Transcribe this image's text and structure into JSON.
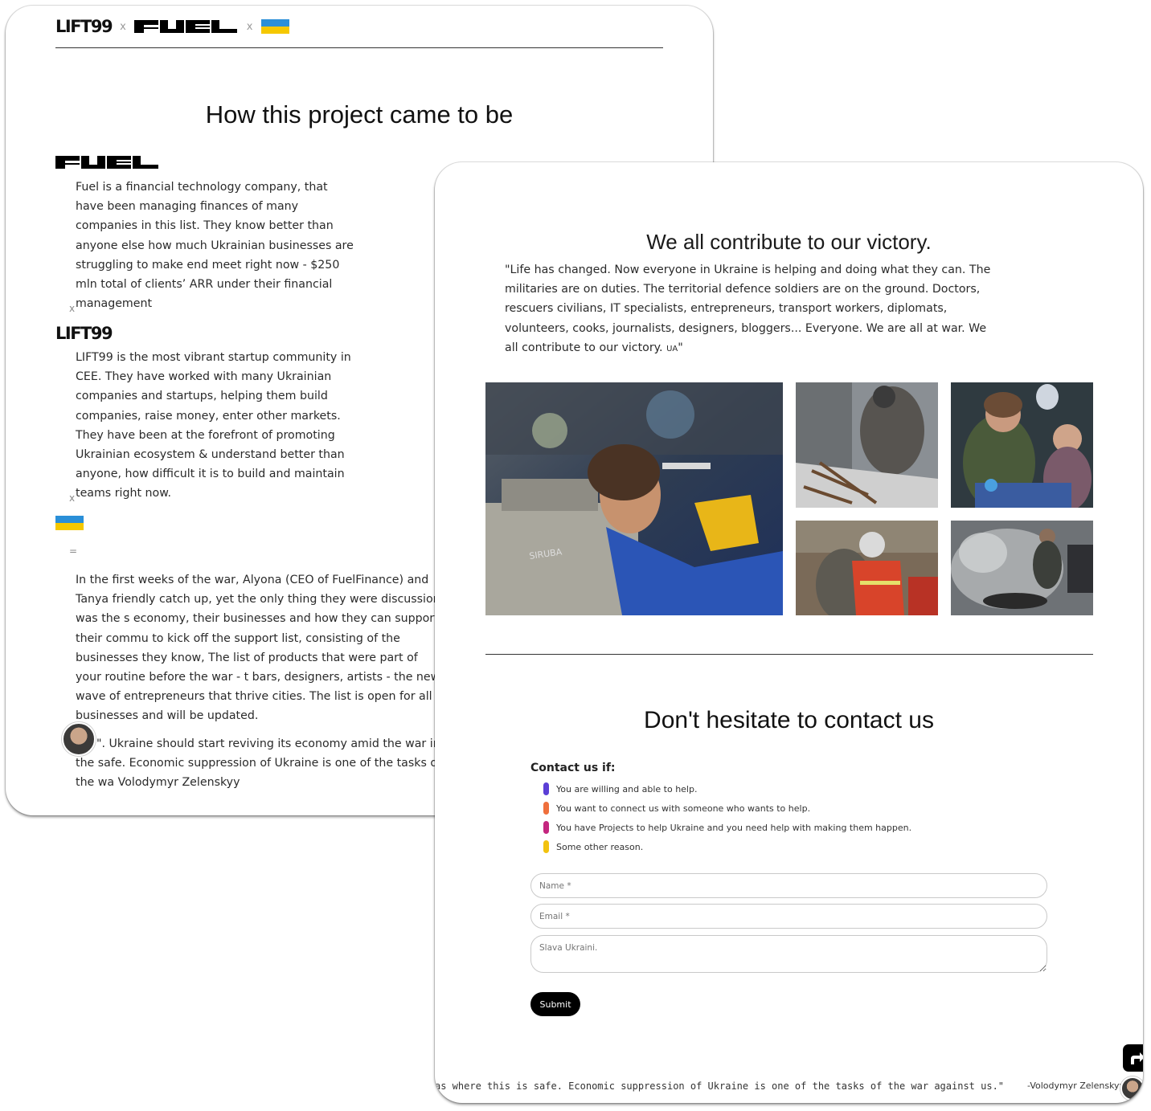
{
  "colors": {
    "flag_blue": "#2a8fd8",
    "flag_yellow": "#f5c800",
    "reason_purple": "#5b3fd6",
    "reason_orange": "#ef6f3c",
    "reason_magenta": "#c4267f",
    "reason_yellow": "#f2c20f"
  },
  "left_card": {
    "header": {
      "lift_logo": "LIFT99",
      "sep1": "x",
      "fuel_logo": "FUEL",
      "sep2": "x"
    },
    "title": "How this project came to be",
    "fuel_logo": "FUEL",
    "fuel_text": "Fuel is a financial technology company, that have been managing finances of many companies in this list. They know better than anyone else how much Ukrainian businesses are struggling to make end meet right now - $250 mln total of clients’ ARR under their financial management",
    "x1": "x",
    "lift_logo": "LIFT99",
    "lift_text": "LIFT99 is the most vibrant startup community in CEE. They have worked with many Ukrainian companies and startups, helping them build companies, raise money, enter other markets. They have been at the forefront of promoting Ukrainian ecosystem & understand better than anyone, how difficult it is to build and maintain teams right now.",
    "x2": "x",
    "eq": "=",
    "story_text": "In the first weeks of the war, Alyona (CEO of FuelFinance) and Tanya friendly catch up, yet the only thing they were discussion was the s economy, their businesses and how they can support their commu to kick off the support list, consisting of the businesses they know, The list of products that were part of your routine before the war - t bars, designers, artists - the new wave of entrepreneurs that thrive cities. The list is open for all businesses and will be updated.",
    "quote_text": "\". Ukraine should start reviving its economy amid the war in the safe. Economic suppression of Ukraine is one of the tasks of the wa Volodymyr Zelenskyy"
  },
  "right_card": {
    "title": "We all contribute to our victory.",
    "quote": "\"Life has changed. Now everyone in Ukraine is helping and doing what they can. The militaries are on duties. The territorial defence soldiers are on the ground. Doctors, rescuers civilians, IT specialists, entrepreneurs, transport workers, diplomats, volunteers, cooks, journalists, designers, bloggers... Everyone. We are all at war. We all contribute to our victory. ",
    "quote_ua": "UA",
    "quote_end": "\"",
    "contact_title": "Don't hesitate to contact us",
    "contact_if": "Contact us if:",
    "reasons": [
      "You are willing and able to help.",
      "You want to connect us with someone who wants to help.",
      "You have Projects to help Ukraine and you need help with making them happen.",
      "Some other reason."
    ],
    "form": {
      "name_placeholder": "Name *",
      "email_placeholder": "Email *",
      "message_placeholder": "Slava Ukraini.",
      "submit": "Submit"
    },
    "ticker_text": "as where this is safe. Economic suppression of Ukraine is one of the tasks of the war against us.\"",
    "ticker_author": "-Volodymyr Zelenskyy",
    "photo_text": "SIRUBA"
  }
}
